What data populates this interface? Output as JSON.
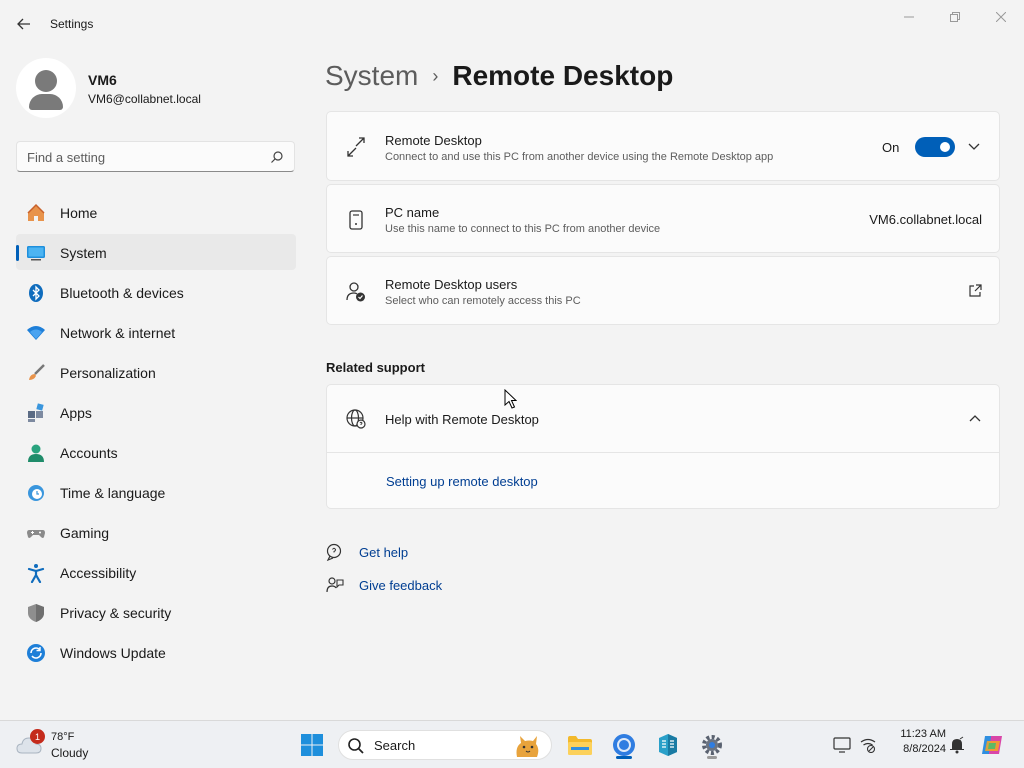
{
  "window": {
    "app_title": "Settings",
    "back_icon": "arrow-left-icon",
    "controls": [
      "minimize-icon",
      "maximize-icon",
      "close-icon"
    ]
  },
  "profile": {
    "name": "VM6",
    "email": "VM6@collabnet.local"
  },
  "search": {
    "placeholder": "Find a setting",
    "value": ""
  },
  "nav": {
    "items": [
      {
        "label": "Home",
        "icon": "home-icon",
        "active": false
      },
      {
        "label": "System",
        "icon": "system-monitor-icon",
        "active": true
      },
      {
        "label": "Bluetooth & devices",
        "icon": "bluetooth-icon",
        "active": false
      },
      {
        "label": "Network & internet",
        "icon": "wifi-icon",
        "active": false
      },
      {
        "label": "Personalization",
        "icon": "paintbrush-icon",
        "active": false
      },
      {
        "label": "Apps",
        "icon": "apps-icon",
        "active": false
      },
      {
        "label": "Accounts",
        "icon": "person-icon",
        "active": false
      },
      {
        "label": "Time & language",
        "icon": "clock-globe-icon",
        "active": false
      },
      {
        "label": "Gaming",
        "icon": "gamepad-icon",
        "active": false
      },
      {
        "label": "Accessibility",
        "icon": "accessibility-icon",
        "active": false
      },
      {
        "label": "Privacy & security",
        "icon": "shield-icon",
        "active": false
      },
      {
        "label": "Windows Update",
        "icon": "update-icon",
        "active": false
      }
    ]
  },
  "breadcrumb": {
    "parent": "System",
    "separator": "›",
    "current": "Remote Desktop"
  },
  "remote_desktop": {
    "title": "Remote Desktop",
    "description": "Connect to and use this PC from another device using the Remote Desktop app",
    "toggle_label": "On",
    "toggle_on": true
  },
  "pc_name": {
    "title": "PC name",
    "description": "Use this name to connect to this PC from another device",
    "value": "VM6.collabnet.local"
  },
  "rd_users": {
    "title": "Remote Desktop users",
    "description": "Select who can remotely access this PC"
  },
  "related_support": {
    "section_title": "Related support",
    "help_title": "Help with Remote Desktop",
    "expanded": true,
    "links": [
      "Setting up remote desktop"
    ]
  },
  "footer": {
    "get_help": "Get help",
    "give_feedback": "Give feedback"
  },
  "taskbar": {
    "weather_temp": "78°F",
    "weather_desc": "Cloudy",
    "weather_badge": "1",
    "search_label": "Search",
    "time": "11:23 AM",
    "date": "8/8/2024"
  },
  "colors": {
    "accent": "#005fb8",
    "link": "#003e92",
    "background": "#f3f3f3",
    "card": "#fbfbfb"
  }
}
